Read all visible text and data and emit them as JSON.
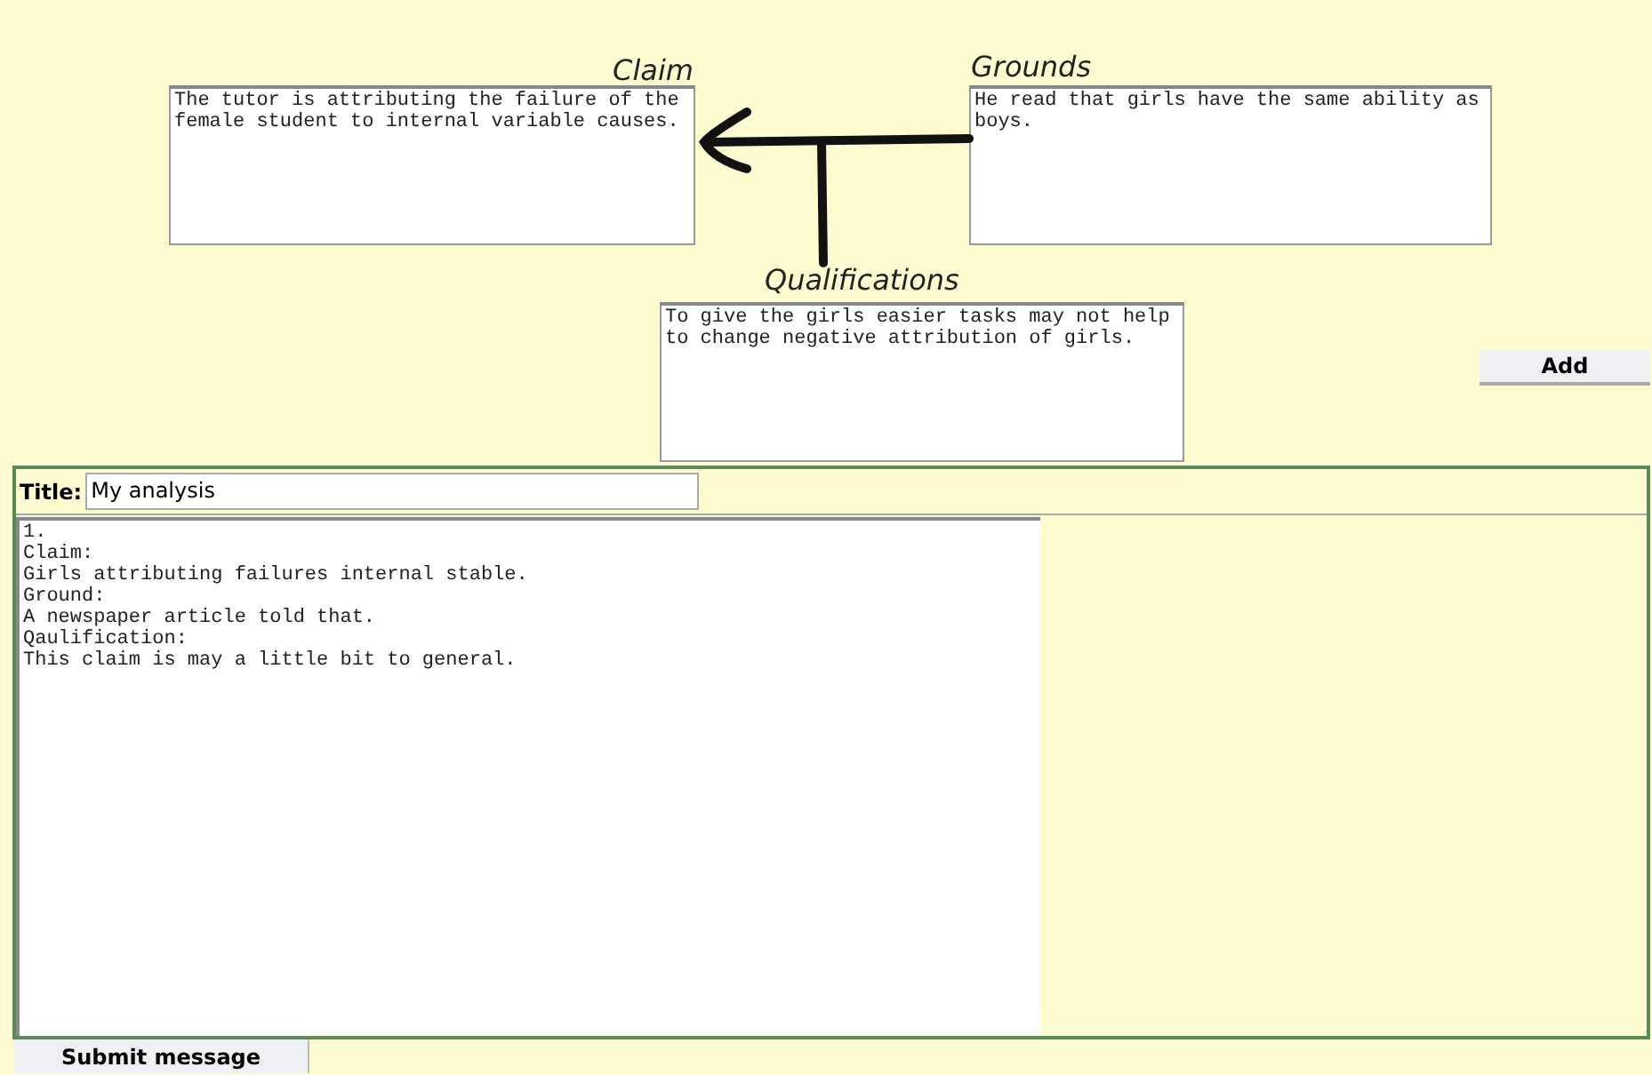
{
  "diagram": {
    "claim": {
      "label": "Claim",
      "text": "The tutor is attributing the failure of the female student to internal variable causes."
    },
    "grounds": {
      "label": "Grounds",
      "text": "He read that girls have the same ability as boys."
    },
    "qualifications": {
      "label": "Qualifications",
      "text": "To give the girls easier tasks may not help to change negative attribution of girls."
    },
    "add_button": "Add"
  },
  "analysis": {
    "title_label": "Title:",
    "title_value": "My analysis",
    "body": "1.\nClaim:\nGirls attributing failures internal stable.\nGround:\nA newspaper article told that.\nQaulification:\nThis claim is may a little bit to general."
  },
  "submit_button": "Submit message"
}
